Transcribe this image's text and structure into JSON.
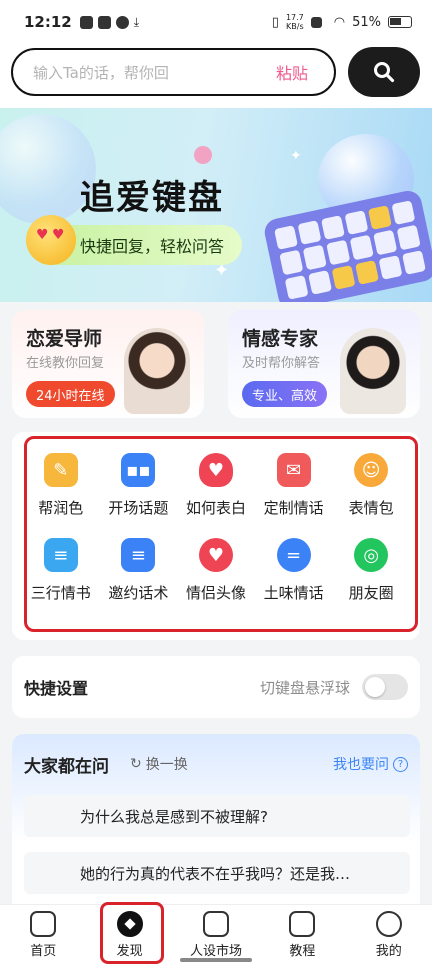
{
  "status_bar": {
    "time": "12:12",
    "net_speed": "17.7\nKB/s",
    "battery": "51%"
  },
  "search": {
    "placeholder": "输入Ta的话，帮你回",
    "paste_label": "粘贴"
  },
  "banner": {
    "title": "追爱键盘",
    "subtitle": "快捷回复，轻松问答"
  },
  "cards": [
    {
      "title": "恋爱导师",
      "subtitle": "在线教你回复",
      "tag": "24小时在线"
    },
    {
      "title": "情感专家",
      "subtitle": "及时帮你解答",
      "tag": "专业、高效"
    }
  ],
  "features": [
    {
      "label": "帮润色",
      "icon": "pen-icon",
      "color": "#f6b73c"
    },
    {
      "label": "开场话题",
      "icon": "chat-icon",
      "color": "#3b82f6"
    },
    {
      "label": "如何表白",
      "icon": "heart-icon",
      "color": "#ef4454"
    },
    {
      "label": "定制情话",
      "icon": "envelope-icon",
      "color": "#f05a5a"
    },
    {
      "label": "表情包",
      "icon": "smile-icon",
      "color": "#f9a83a"
    },
    {
      "label": "三行情书",
      "icon": "letter-icon",
      "color": "#3aa7f0"
    },
    {
      "label": "邀约话术",
      "icon": "invite-icon",
      "color": "#3b82f6"
    },
    {
      "label": "情侣头像",
      "icon": "couple-icon",
      "color": "#ef4454"
    },
    {
      "label": "土味情话",
      "icon": "talk-icon",
      "color": "#3b82f6"
    },
    {
      "label": "朋友圈",
      "icon": "moments-icon",
      "color": "#22c55e"
    }
  ],
  "quick_settings": {
    "title": "快捷设置",
    "toggle_label": "切键盘悬浮球",
    "toggle_on": false
  },
  "ask": {
    "title": "大家都在问",
    "refresh_label": "换一换",
    "ask_link": "我也要问",
    "questions": [
      "为什么我总是感到不被理解?",
      "她的行为真的代表不在乎我吗？还是我…"
    ]
  },
  "tabbar": {
    "items": [
      {
        "label": "首页",
        "icon": "home-icon"
      },
      {
        "label": "发现",
        "icon": "compass-icon",
        "active": true
      },
      {
        "label": "人设市场",
        "icon": "store-icon"
      },
      {
        "label": "教程",
        "icon": "book-icon"
      },
      {
        "label": "我的",
        "icon": "profile-icon"
      }
    ]
  }
}
